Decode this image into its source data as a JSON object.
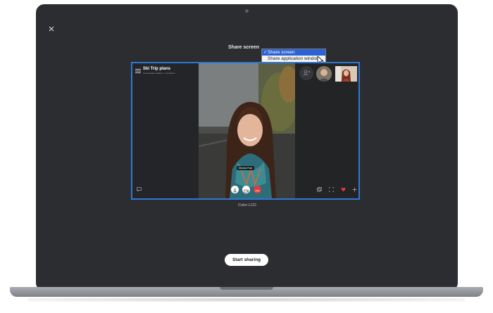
{
  "dialog": {
    "title": "Share screen",
    "display_name": "Color LCD",
    "start_label": "Start sharing"
  },
  "dropdown": {
    "options": [
      {
        "label": "Share screen",
        "selected": true,
        "check": "✓"
      },
      {
        "label": "Share application window",
        "selected": false
      }
    ]
  },
  "preview": {
    "chat_title": "Ski Trip plans",
    "chat_subtitle": "Conversation started · 4 members",
    "name_tag": "Monica Ruiz"
  },
  "colors": {
    "accent_border": "#2f78d4",
    "dropdown_selected": "#2b63d4",
    "end_call": "#e23b3b",
    "heart": "#e23b3b"
  },
  "icons": [
    "close-icon",
    "hamburger-icon",
    "chat-icon",
    "add-person-icon",
    "mic-icon",
    "camera-icon",
    "end-call-icon",
    "popout-icon",
    "fullscreen-icon",
    "heart-icon",
    "plus-icon",
    "checkmark-icon",
    "mouse-cursor-icon"
  ]
}
